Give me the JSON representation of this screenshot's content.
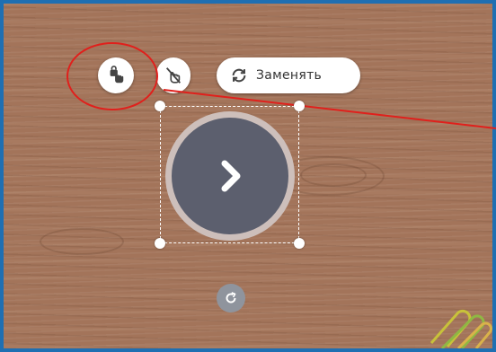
{
  "toolbar": {
    "lock_icon": "hand-lock-icon",
    "unlink_icon": "hand-unlink-icon",
    "replace_icon": "refresh-icon",
    "replace_label": "Заменять"
  },
  "canvas": {
    "background": "wood-texture",
    "selected_element": {
      "icon": "chevron-right-icon",
      "fill": "#5c5f6e",
      "ring": "#cdbfbb"
    },
    "rotate_icon": "rotate-icon"
  },
  "annotation": {
    "color": "#e0201c",
    "shape": "circle-with-pointer-line"
  }
}
